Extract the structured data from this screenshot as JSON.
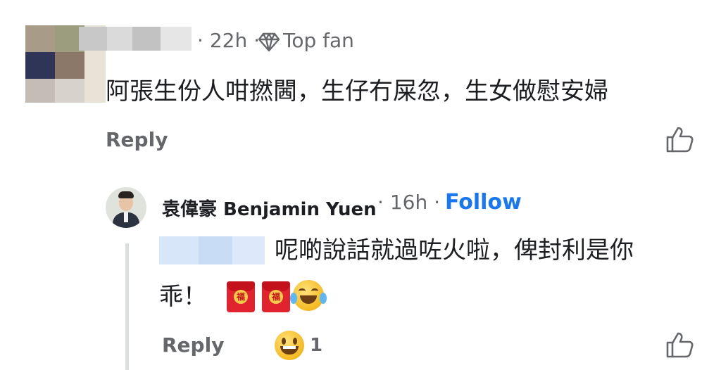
{
  "comment1": {
    "time": "22h",
    "separator": "·",
    "badge": "Top fan",
    "text": "阿張生份人咁撚閪，生仔冇屎忽，生女做慰安婦",
    "reply_label": "Reply"
  },
  "comment2": {
    "author": "袁偉豪 Benjamin Yuen",
    "time": "16h",
    "separator": "·",
    "follow_label": "Follow",
    "text_line1": "呢啲說話就過咗火啦，俾封利是你",
    "text_line2": "乖！",
    "reply_label": "Reply",
    "reaction_count": "1",
    "red_packet_char": "福"
  },
  "icons": {
    "badge": "diamond-icon",
    "like": "thumbs-up-icon",
    "reaction": "grinning-emoji-icon",
    "tears": "tears-of-joy-emoji-icon",
    "red_packet": "red-packet-icon"
  },
  "colors": {
    "follow": "#1877f2",
    "meta": "#65676b",
    "text": "#1c1e21"
  }
}
